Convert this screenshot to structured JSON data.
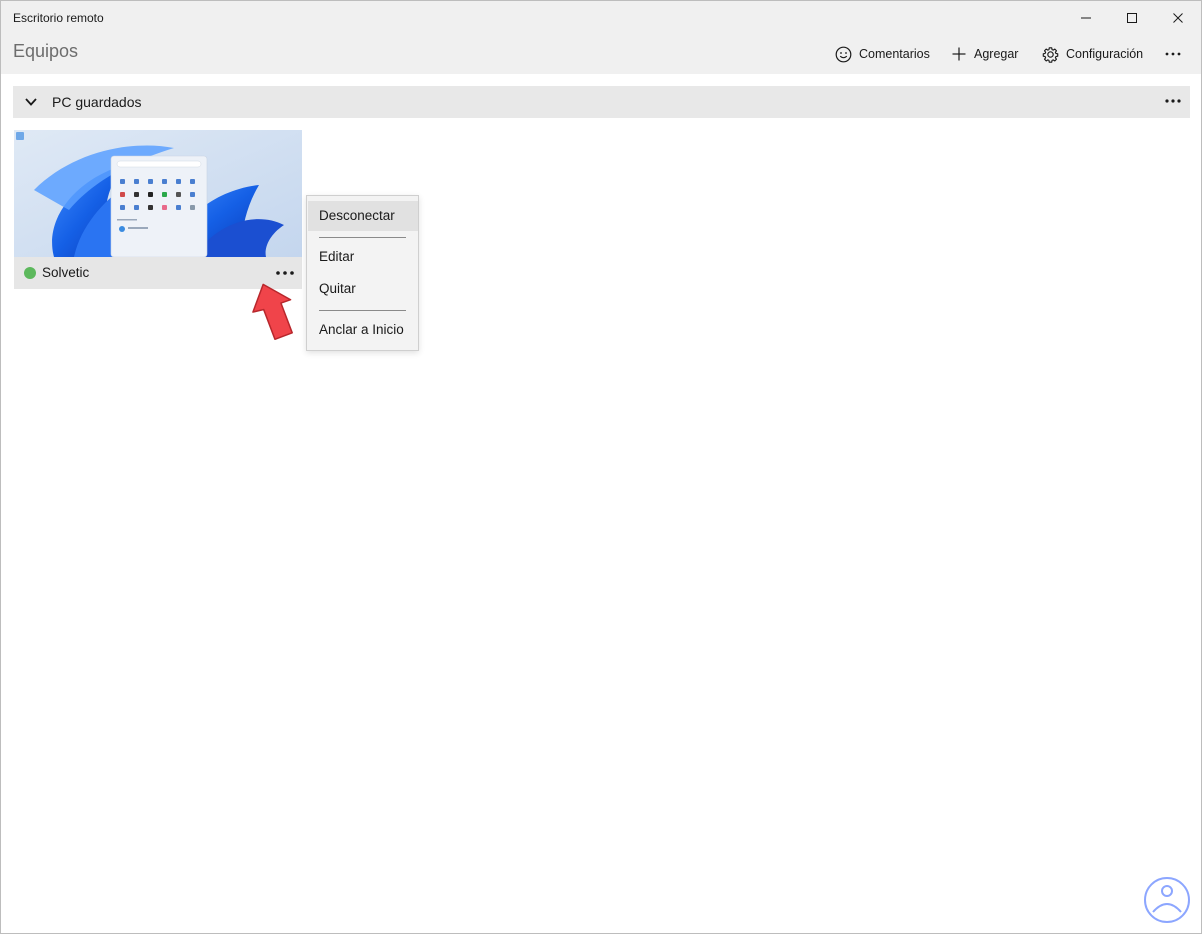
{
  "window": {
    "title": "Escritorio remoto"
  },
  "header": {
    "page_title": "Equipos",
    "commands": [
      {
        "label": "Comentarios",
        "icon": "smiley-icon"
      },
      {
        "label": "Agregar",
        "icon": "plus-icon"
      },
      {
        "label": "Configuración",
        "icon": "gear-icon"
      }
    ],
    "more_icon": "ellipsis-icon"
  },
  "group": {
    "label": "PC guardados",
    "expanded": true
  },
  "tiles": [
    {
      "name": "Solvetic",
      "status": "connected",
      "status_color": "#5cb85c"
    }
  ],
  "context_menu": {
    "items": [
      "Desconectar",
      "Editar",
      "Quitar",
      "Anclar a Inicio"
    ]
  },
  "colors": {
    "chrome": "#f0f0f0",
    "group_bar": "#e8e8e8",
    "accent_arrow": "#f0444a",
    "watermark": "#2e5cff"
  }
}
